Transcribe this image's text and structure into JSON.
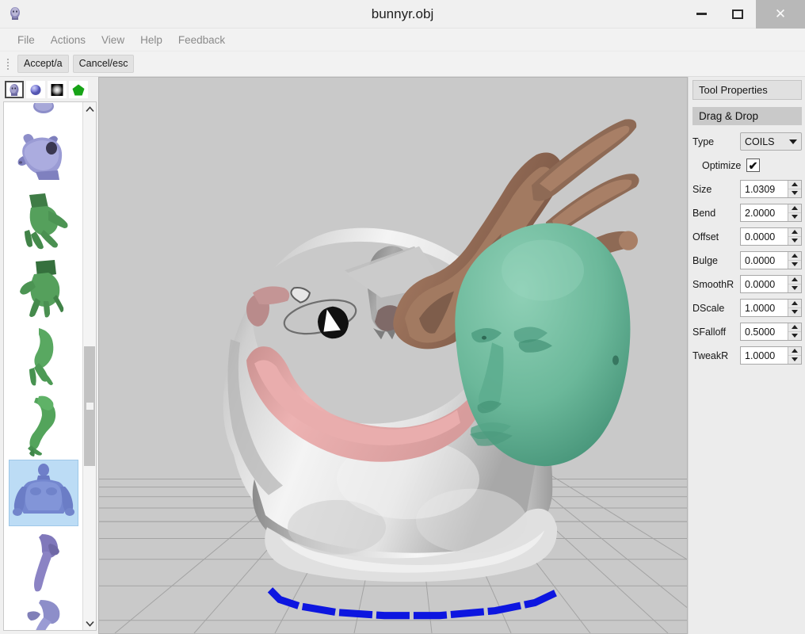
{
  "window": {
    "title": "bunnyr.obj",
    "app_icon": "head-icon",
    "minimize_label": "–",
    "maximize_label": "□",
    "close_label": "✕"
  },
  "menubar": {
    "items": [
      {
        "label": "File",
        "name": "menu-file"
      },
      {
        "label": "Actions",
        "name": "menu-actions"
      },
      {
        "label": "View",
        "name": "menu-view"
      },
      {
        "label": "Help",
        "name": "menu-help"
      },
      {
        "label": "Feedback",
        "name": "menu-feedback"
      }
    ]
  },
  "toolbar": {
    "accept_label": "Accept/a",
    "cancel_label": "Cancel/esc"
  },
  "sidebar": {
    "tabs": [
      {
        "name": "tab-meshes",
        "icon": "head-icon",
        "selected": true
      },
      {
        "name": "tab-materials",
        "icon": "sphere-icon",
        "selected": false
      },
      {
        "name": "tab-gradients",
        "icon": "gradient-square-icon",
        "selected": false
      },
      {
        "name": "tab-primitives",
        "icon": "pentagon-icon",
        "selected": false
      }
    ],
    "scroll": {
      "up_arrow": "⌃",
      "down_arrow": "⌄"
    },
    "items": [
      {
        "name": "library-item-cow-head",
        "shape": "cow-head",
        "color": "#8d8ec9",
        "selected": false
      },
      {
        "name": "library-item-hand-a",
        "shape": "hand",
        "color": "#4f9455",
        "selected": false
      },
      {
        "name": "library-item-hand-b",
        "shape": "hand2",
        "color": "#4f9455",
        "selected": false
      },
      {
        "name": "library-item-arm-a",
        "shape": "arm",
        "color": "#5ba862",
        "selected": false
      },
      {
        "name": "library-item-arm-b",
        "shape": "arm2",
        "color": "#5ba862",
        "selected": false
      },
      {
        "name": "library-item-torso",
        "shape": "torso",
        "color": "#6f7fc9",
        "selected": true
      },
      {
        "name": "library-item-leg-a",
        "shape": "leg",
        "color": "#8078bb",
        "selected": false
      },
      {
        "name": "library-item-leg-b",
        "shape": "leg2",
        "color": "#8d8ec9",
        "selected": false
      }
    ]
  },
  "properties": {
    "panel_title": "Tool Properties",
    "section_title": "Drag & Drop",
    "type": {
      "label": "Type",
      "value": "COILS"
    },
    "optimize": {
      "label": "Optimize",
      "checked": true,
      "tick": "✔"
    },
    "fields": [
      {
        "label": "Size",
        "value": "1.0309",
        "name": "size-field"
      },
      {
        "label": "Bend",
        "value": "2.0000",
        "name": "bend-field"
      },
      {
        "label": "Offset",
        "value": "0.0000",
        "name": "offset-field"
      },
      {
        "label": "Bulge",
        "value": "0.0000",
        "name": "bulge-field"
      },
      {
        "label": "SmoothR",
        "value": "0.0000",
        "name": "smoothr-field"
      },
      {
        "label": "DScale",
        "value": "1.0000",
        "name": "dscale-field"
      },
      {
        "label": "SFalloff",
        "value": "0.5000",
        "name": "sfalloff-field"
      },
      {
        "label": "TweakR",
        "value": "1.0000",
        "name": "tweakr-field"
      }
    ]
  },
  "viewport": {
    "background_color": "#c9c9c9",
    "grid_color": "#9a9a9a",
    "base_contour_color": "#0d16e0",
    "meshes": [
      {
        "name": "bunny-body",
        "color": "#e8e8e8"
      },
      {
        "name": "bunny-interior-pink",
        "color": "#e7a8a8"
      },
      {
        "name": "bunny-ear",
        "color": "#9a9a9a"
      },
      {
        "name": "arm-mesh",
        "color": "#8b6652"
      },
      {
        "name": "head-mesh",
        "color": "#63b396"
      }
    ],
    "brush_cursor": "brush-ellipse-cursor"
  }
}
